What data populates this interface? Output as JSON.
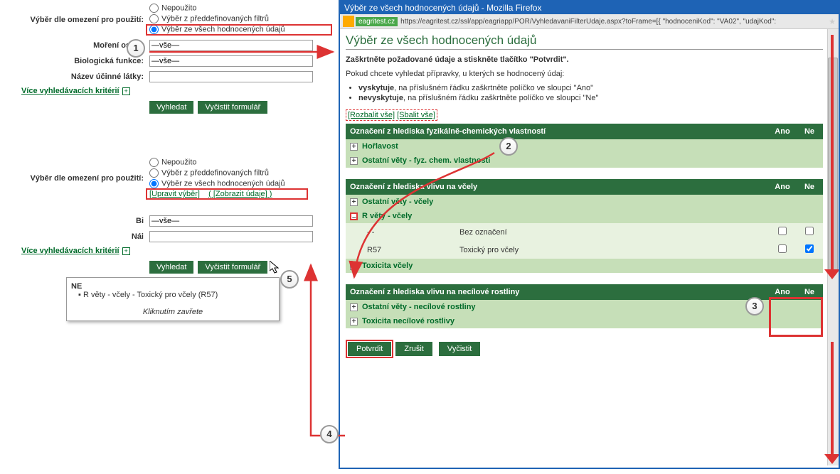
{
  "left1": {
    "lblFilter": "Výběr dle omezení pro použití:",
    "rNone": "Nepoužito",
    "rPre": "Výběr z předdefinovaných filtrů",
    "rAll": "Výběr ze všech hodnocených údajů",
    "lblMor": "Moření osiva:",
    "lblBio": "Biologická funkce:",
    "lblLat": "Název účinné látky:",
    "valDash": "—vše—",
    "linkMore": "Více vyhledávacích kritérií",
    "btnSearch": "Vyhledat",
    "btnClear": "Vyčistit formulář"
  },
  "left2": {
    "linkEdit": "[Upravit výběr]",
    "linkShow": "( [Zobrazit údaje] )"
  },
  "tooltip": {
    "title": "NE",
    "item": "R věty - včely - Toxický pro včely (R57)",
    "close": "Kliknutím zavřete"
  },
  "win": {
    "title": "Výběr ze všech hodnocených údajů - Mozilla Firefox",
    "chip": "eagritest.cz",
    "url": "https://eagritest.cz/ssl/app/eagriapp/POR/VyhledavaniFilterUdaje.aspx?toFrame=[{ \"hodnoceniKod\": \"VA02\", \"udajKod\":"
  },
  "page": {
    "title": "Výběr ze všech hodnocených údajů",
    "instr": "Zaškrtněte požadované údaje a stiskněte tlačítko \"Potvrdit\".",
    "lead": "Pokud chcete vyhledat přípravky, u kterých se hodnocený údaj:",
    "liYes": "vyskytuje",
    "liYesRest": ", na příslušném řádku zaškrtněte políčko ve sloupci \"Ano\"",
    "liNo": "nevyskytuje",
    "liNoRest": ", na příslušném řádku zaškrtněte políčko ve sloupci \"Ne\"",
    "expAll": "[Rozbalit vše]",
    "colAll": "[Sbalit vše]",
    "colAno": "Ano",
    "colNe": "Ne"
  },
  "t1": {
    "head": "Označení z hlediska fyzikálně-chemických vlastností",
    "r1": "Hořlavost",
    "r2": "Ostatní věty - fyz. chem. vlastnosti"
  },
  "t2": {
    "head": "Označení z hlediska vlivu na včely",
    "r1": "Ostatní věty - včely",
    "r2": "R věty - včely",
    "r2a_code": "- -",
    "r2a_desc": "Bez označení",
    "r2b_code": "R57",
    "r2b_desc": "Toxický pro včely",
    "r3": "Toxicita včely"
  },
  "t3": {
    "head": "Označení z hlediska vlivu na necílové rostliny",
    "r1": "Ostatní věty - necílové rostliny",
    "r2": "Toxicita necílové rostlivy"
  },
  "btns": {
    "ok": "Potvrdit",
    "cancel": "Zrušit",
    "clear": "Vyčistit"
  },
  "badges": {
    "b1": "1",
    "b2": "2",
    "b3": "3",
    "b4": "4",
    "b5": "5"
  }
}
